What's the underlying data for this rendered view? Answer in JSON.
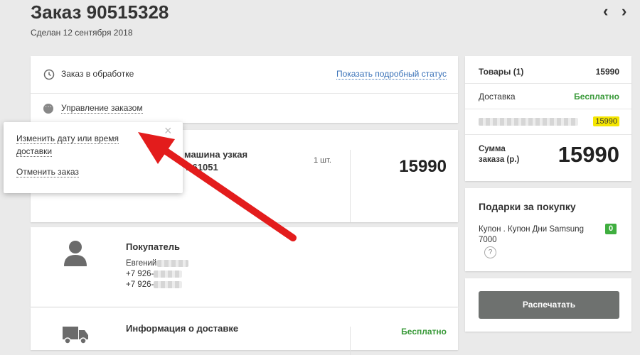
{
  "header": {
    "title": "Заказ 90515328",
    "date": "Сделан 12 сентября 2018",
    "prev_icon": "‹",
    "next_icon": "›"
  },
  "status_card": {
    "status_text": "Заказ в обработке",
    "status_link": "Показать подробный статус",
    "manage_label": "Управление заказом"
  },
  "popup": {
    "change_date_line1": "Изменить дату или время",
    "change_date_line2": "доставки",
    "cancel_label": "Отменить заказ",
    "close_icon": "×"
  },
  "item": {
    "name_line1": "машина узкая",
    "name_line2": "Т 61051",
    "quantity": "1 шт.",
    "price": "15990"
  },
  "buyer": {
    "title": "Покупатель",
    "name": "Евгений",
    "phone1": "+7 926-",
    "phone2": "+7 926-"
  },
  "delivery": {
    "title": "Информация о доставке",
    "price": "Бесплатно"
  },
  "summary": {
    "items_label": "Товары (1)",
    "items_value": "15990",
    "delivery_label": "Доставка",
    "delivery_value": "Бесплатно",
    "hidden_value": "15990",
    "total_label_line1": "Сумма",
    "total_label_line2": "заказа (р.)",
    "total_value": "15990"
  },
  "gifts": {
    "title": "Подарки за покупку",
    "coupon_text": "Купон . Купон Дни Samsung 7000",
    "coupon_count": "0",
    "help_icon": "?"
  },
  "print": {
    "button_label": "Распечатать"
  },
  "colors": {
    "accent_green": "#3a9a3a",
    "link_blue": "#3a72b8",
    "highlight_yellow": "#f5e600",
    "button_gray": "#6e716f",
    "arrow_red": "#e31c1c"
  }
}
